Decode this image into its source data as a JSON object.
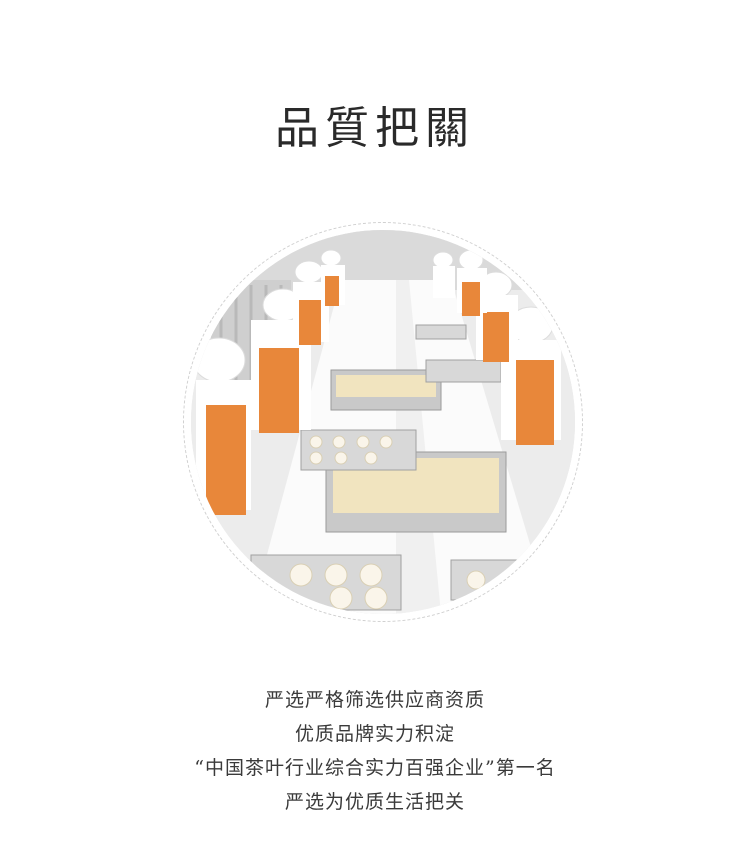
{
  "page": {
    "title": "品質把關",
    "photo_alt": "workers-packing-pastries-on-production-line",
    "copy_lines": [
      "严选严格筛选供应商资质",
      "优质品牌实力积淀",
      "“中国茶叶行业综合实力百强企业”第一名",
      "严选为优质生活把关"
    ]
  },
  "colors": {
    "apron": "#e8873a",
    "uniform": "#ffffff",
    "tray": "#bdbdbd",
    "dough": "#f1e4bf",
    "table": "#f7f7f7"
  }
}
